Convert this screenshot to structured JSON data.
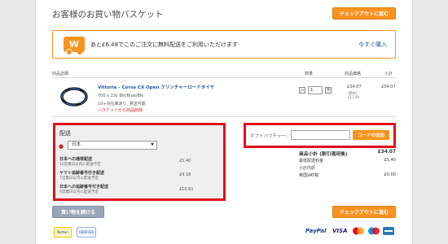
{
  "page": {
    "title": "お客様のお買い物バスケット"
  },
  "buttons": {
    "checkout": "チェックアウトに進む",
    "continue": "買い物を続ける"
  },
  "promo": {
    "icon_letter": "W",
    "text": "あと£6.48でこのご注文に無料配送をご利用いただけます",
    "link": "今すぐ購入"
  },
  "table": {
    "headers": {
      "details": "商品詳細",
      "qty": "数量",
      "price": "商品価格",
      "subtotal": "小計"
    }
  },
  "product": {
    "name": "Vittoria - Corsa CX Open クリンチャーロードタイヤ",
    "variant": "700 x 23c Blk/Blue/Blk",
    "stock": "10+点在庫あり, 発送可能",
    "remove": "バスケットから商品削除",
    "qty": "1",
    "price": "£34.07",
    "price_note_1": "(節約)",
    "price_note_2": "£11.90",
    "subtotal": "£34.07"
  },
  "shipping": {
    "title": "配送",
    "country": "日本",
    "options": [
      {
        "name": "日本への通常配送",
        "eta": "10営業日以内に配送予定",
        "price": "£5.40"
      },
      {
        "name": "ヤマト追跡番号付き配送",
        "eta": "7営業日以内に配送予定",
        "price": "£9.18"
      },
      {
        "name": "日本への追跡番号付き配送",
        "eta": "6営業日以内に配送予定",
        "price": "£10.81"
      }
    ]
  },
  "gift": {
    "label": "ギフトバウチャー:",
    "button": "コードの追加"
  },
  "summary": {
    "rows": [
      {
        "label": "商品小計 (割引適用後)",
        "value": "£34.07"
      },
      {
        "label": "最低配送料金",
        "value": "£5.40"
      },
      {
        "label": "小計内訳",
        "value": ""
      },
      {
        "label": "英国VAT税",
        "value": "£0.00"
      }
    ]
  },
  "badges": {
    "norton": "Norton",
    "verified": "VERIFIED"
  },
  "payment": {
    "paypal": "PayPal",
    "visa": "VISA"
  },
  "colors": {
    "accent": "#f7931e",
    "highlight_border": "#e3101a",
    "link": "#1d5aa8"
  }
}
